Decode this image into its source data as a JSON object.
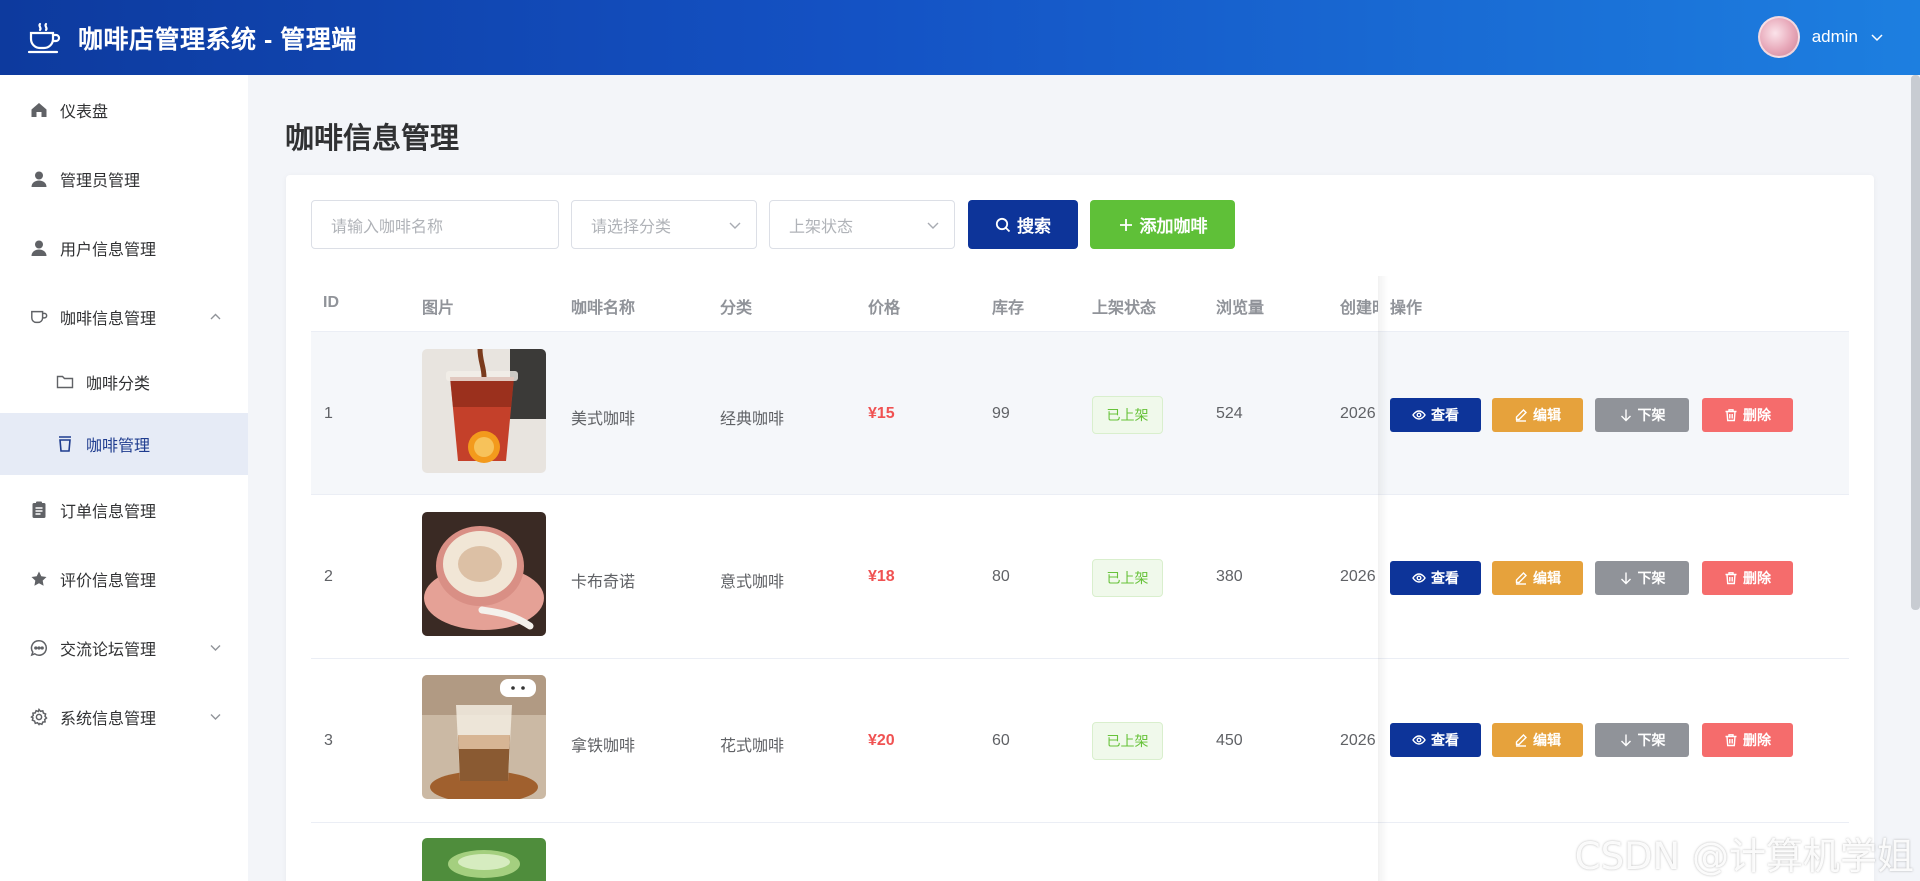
{
  "header": {
    "title": "咖啡店管理系统 - 管理端",
    "username": "admin"
  },
  "sidebar": {
    "items": [
      {
        "label": "仪表盘",
        "icon": "home-icon"
      },
      {
        "label": "管理员管理",
        "icon": "user-icon"
      },
      {
        "label": "用户信息管理",
        "icon": "user-icon"
      },
      {
        "label": "咖啡信息管理",
        "icon": "coffee-cup-icon",
        "expanded": true
      },
      {
        "label": "咖啡分类",
        "icon": "folder-icon",
        "sub": true
      },
      {
        "label": "咖啡管理",
        "icon": "cup-icon",
        "sub": true,
        "active": true
      },
      {
        "label": "订单信息管理",
        "icon": "clipboard-icon"
      },
      {
        "label": "评价信息管理",
        "icon": "star-icon"
      },
      {
        "label": "交流论坛管理",
        "icon": "chat-icon",
        "collapsible": true
      },
      {
        "label": "系统信息管理",
        "icon": "gear-icon",
        "collapsible": true
      }
    ]
  },
  "main": {
    "page_title": "咖啡信息管理",
    "filters": {
      "name_placeholder": "请输入咖啡名称",
      "category_placeholder": "请选择分类",
      "status_placeholder": "上架状态",
      "search_label": "搜索",
      "add_label": "添加咖啡"
    },
    "table": {
      "columns": [
        "ID",
        "图片",
        "咖啡名称",
        "分类",
        "价格",
        "库存",
        "上架状态",
        "浏览量",
        "创建时",
        "操作"
      ],
      "rows": [
        {
          "id": "1",
          "name": "美式咖啡",
          "category": "经典咖啡",
          "price": "¥15",
          "stock": "99",
          "status": "已上架",
          "views": "524",
          "created": "2026"
        },
        {
          "id": "2",
          "name": "卡布奇诺",
          "category": "意式咖啡",
          "price": "¥18",
          "stock": "80",
          "status": "已上架",
          "views": "380",
          "created": "2026"
        },
        {
          "id": "3",
          "name": "拿铁咖啡",
          "category": "花式咖啡",
          "price": "¥20",
          "stock": "60",
          "status": "已上架",
          "views": "450",
          "created": "2026"
        }
      ],
      "actions": {
        "view": "查看",
        "edit": "编辑",
        "takedown": "下架",
        "delete": "删除"
      }
    }
  },
  "watermark": "CSDN @计算机学姐",
  "colors": {
    "primary": "#0d3499",
    "success": "#5fc038",
    "warning": "#e6a23c",
    "danger": "#f56c6c",
    "info": "#909399",
    "price": "#f05252"
  }
}
